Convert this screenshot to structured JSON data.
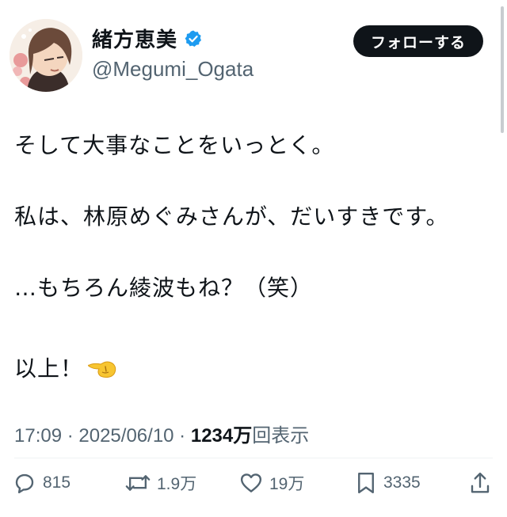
{
  "header": {
    "display_name": "緒方恵美",
    "handle": "@Megumi_Ogata",
    "follow_label": "フォローする",
    "verified_color": "#1d9bf0"
  },
  "body": {
    "lines": [
      "そして大事なことをいっとく。",
      "私は、林原めぐみさんが、だいすきです。",
      "…もちろん綾波もね？（笑）",
      "以上！"
    ],
    "trailing_emoji": "pointing-hand-emoji"
  },
  "meta": {
    "time": "17:09",
    "date": "2025/06/10",
    "views_count": "1234万",
    "views_label": "回表示"
  },
  "actions": {
    "replies": "815",
    "reposts": "1.9万",
    "likes": "19万",
    "bookmarks": "3335"
  }
}
